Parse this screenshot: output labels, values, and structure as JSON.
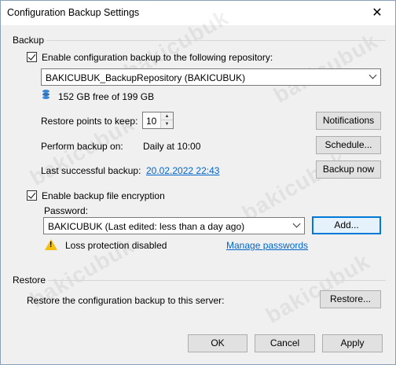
{
  "window": {
    "title": "Configuration Backup Settings",
    "close_glyph": "✕"
  },
  "backup": {
    "section_label": "Backup",
    "enable_label": "Enable configuration backup to the following repository:",
    "repository": "BAKICUBUK_BackupRepository (BAKICUBUK)",
    "free_space": "152 GB free of 199 GB",
    "restore_points_label": "Restore points to keep:",
    "restore_points_value": "10",
    "notifications_label": "Notifications",
    "perform_label": "Perform backup on:",
    "perform_value": "Daily at 10:00",
    "schedule_label": "Schedule...",
    "last_label": "Last successful backup:",
    "last_value": "20.02.2022 22:43",
    "backup_now_label": "Backup now",
    "encryption_label": "Enable backup file encryption",
    "password_label": "Password:",
    "password_value": "BAKICUBUK (Last edited: less than a day ago)",
    "add_label": "Add...",
    "loss_protection": "Loss protection disabled",
    "manage_passwords": "Manage passwords"
  },
  "restore": {
    "section_label": "Restore",
    "description": "Restore the configuration backup to this server:",
    "restore_button": "Restore..."
  },
  "footer": {
    "ok": "OK",
    "cancel": "Cancel",
    "apply": "Apply"
  },
  "watermark_text": "bakicubuk",
  "colors": {
    "link": "#0066cc",
    "focus": "#0078d7",
    "warning": "#f3c012",
    "db_icon": "#3a87d6"
  },
  "icons": {
    "close": "close-icon",
    "database": "database-icon",
    "warning": "warning-icon"
  }
}
